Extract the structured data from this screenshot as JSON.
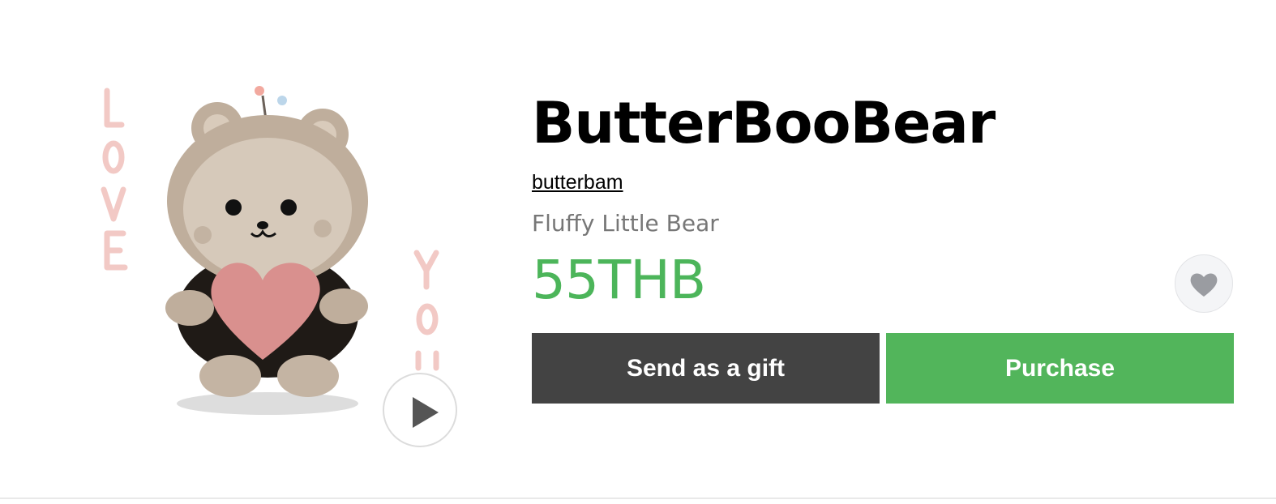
{
  "product": {
    "title": "ButterBooBear",
    "author": "butterbam",
    "description": "Fluffy Little Bear",
    "price": "55THB"
  },
  "actions": {
    "gift_label": "Send as a gift",
    "purchase_label": "Purchase"
  },
  "icons": {
    "play": "play-icon",
    "favorite": "heart-icon"
  },
  "colors": {
    "price": "#4cb55a",
    "purchase_button": "#52b55b",
    "gift_button": "#434343"
  }
}
